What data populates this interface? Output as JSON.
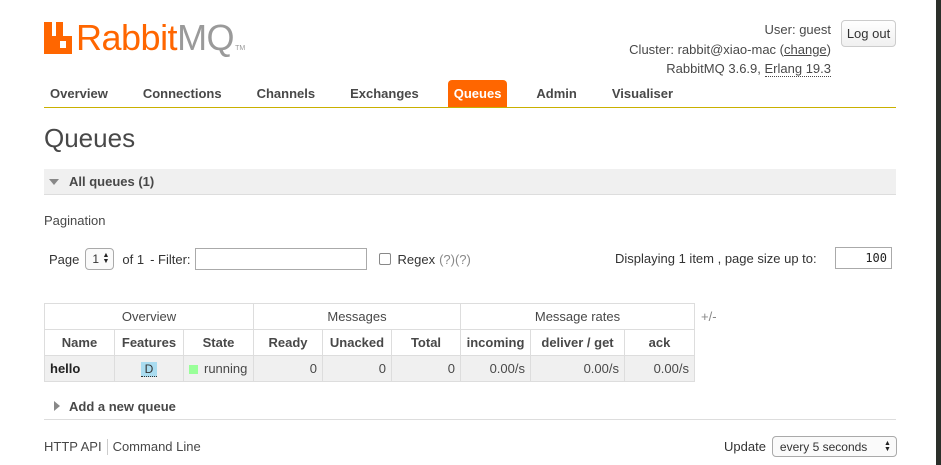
{
  "header": {
    "logo_brand": "Rabbit",
    "logo_product": "MQ",
    "logo_tm": "TM",
    "user_label": "User:",
    "user_value": "guest",
    "cluster_label": "Cluster:",
    "cluster_value": "rabbit@xiao-mac",
    "change_link": "change",
    "version": "RabbitMQ 3.6.9,",
    "erlang": "Erlang 19.3",
    "logout_label": "Log out"
  },
  "tabs": [
    {
      "label": "Overview",
      "active": false
    },
    {
      "label": "Connections",
      "active": false
    },
    {
      "label": "Channels",
      "active": false
    },
    {
      "label": "Exchanges",
      "active": false
    },
    {
      "label": "Queues",
      "active": true
    },
    {
      "label": "Admin",
      "active": false
    },
    {
      "label": "Visualiser",
      "active": false
    }
  ],
  "page_title": "Queues",
  "all_queues": {
    "title": "All queues (1)"
  },
  "pagination": {
    "label": "Pagination",
    "page_label": "Page",
    "page_value": "1",
    "of_label": "of 1",
    "filter_label": "- Filter:",
    "filter_value": "",
    "regex_label": "Regex",
    "regex_help": "(?)(?)",
    "display_text": "Displaying 1 item , page size up to:",
    "page_size": "100"
  },
  "table": {
    "groups": [
      "Overview",
      "Messages",
      "Message rates"
    ],
    "columns": [
      "Name",
      "Features",
      "State",
      "Ready",
      "Unacked",
      "Total",
      "incoming",
      "deliver / get",
      "ack"
    ],
    "rows": [
      {
        "name": "hello",
        "feature": "D",
        "state": "running",
        "ready": "0",
        "unacked": "0",
        "total": "0",
        "incoming": "0.00/s",
        "deliver_get": "0.00/s",
        "ack": "0.00/s"
      }
    ],
    "plus_minus": "+/-"
  },
  "add_queue": {
    "title": "Add a new queue"
  },
  "footer": {
    "http_api": "HTTP API",
    "command_line": "Command Line",
    "update_label": "Update",
    "update_value": "every 5 seconds"
  },
  "colors": {
    "accent": "#ff6600",
    "running": "#99ff99",
    "feature_badge": "#aadcf0"
  }
}
